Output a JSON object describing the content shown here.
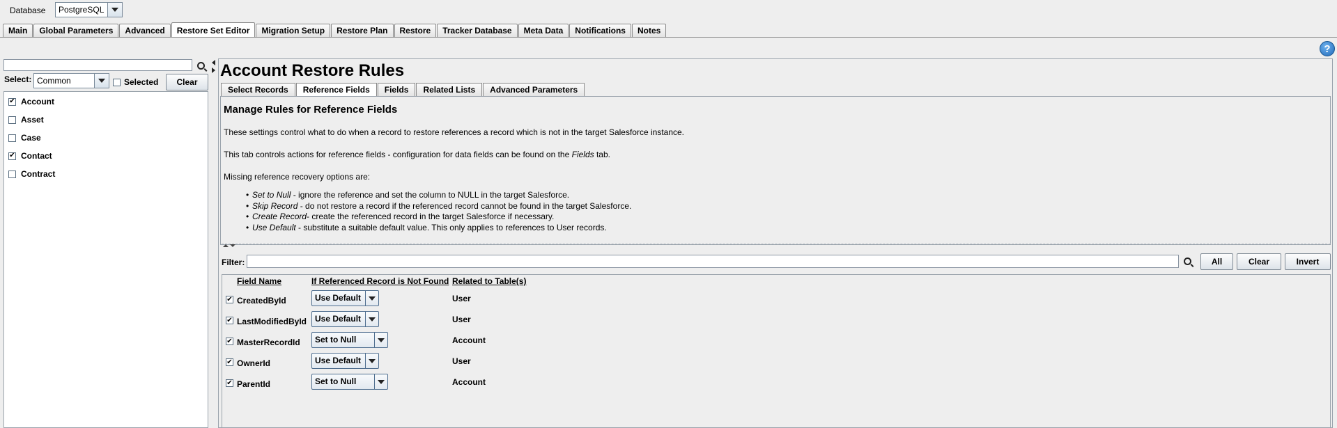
{
  "database": {
    "label": "Database",
    "value": "PostgreSQL"
  },
  "main_tabs": [
    {
      "label": "Main"
    },
    {
      "label": "Global Parameters"
    },
    {
      "label": "Advanced"
    },
    {
      "label": "Restore Set Editor"
    },
    {
      "label": "Migration Setup"
    },
    {
      "label": "Restore Plan"
    },
    {
      "label": "Restore"
    },
    {
      "label": "Tracker Database"
    },
    {
      "label": "Meta Data"
    },
    {
      "label": "Notifications"
    },
    {
      "label": "Notes"
    }
  ],
  "active_main_tab": "Restore Set Editor",
  "left": {
    "search_value": "",
    "select_label": "Select:",
    "select_value": "Common",
    "selected_label": "Selected",
    "clear_label": "Clear",
    "objects": [
      {
        "label": "Account",
        "checked": true
      },
      {
        "label": "Asset",
        "checked": false
      },
      {
        "label": "Case",
        "checked": false
      },
      {
        "label": "Contact",
        "checked": true
      },
      {
        "label": "Contract",
        "checked": false
      }
    ]
  },
  "right": {
    "title": "Account Restore Rules",
    "tabs": [
      {
        "label": "Select Records"
      },
      {
        "label": "Reference Fields"
      },
      {
        "label": "Fields"
      },
      {
        "label": "Related Lists"
      },
      {
        "label": "Advanced Parameters"
      }
    ],
    "active_tab": "Reference Fields",
    "info": {
      "heading": "Manage Rules for Reference Fields",
      "p1": "These settings control what to do when a record to restore references a record which is not in the target Salesforce instance.",
      "p2_pre": "This tab controls actions for reference fields - configuration for data fields can be found on the ",
      "p2_em": "Fields",
      "p2_post": " tab.",
      "p3": "Missing reference recovery options are:",
      "options": [
        {
          "name": "Set to Null",
          "desc": " - ignore the reference and set the column to NULL in the target Salesforce."
        },
        {
          "name": "Skip Record",
          "desc": " - do not restore a record if the referenced record cannot be found in the target Salesforce."
        },
        {
          "name": "Create Record",
          "desc": "- create the referenced record in the target Salesforce if necessary."
        },
        {
          "name": "Use Default",
          "desc": " - substitute a suitable default value. This only applies to references to User records."
        }
      ]
    },
    "filter": {
      "label": "Filter:",
      "value": "",
      "all_label": "All",
      "clear_label": "Clear",
      "invert_label": "Invert"
    },
    "table": {
      "headers": [
        "Field Name",
        "If Referenced Record is Not Found",
        "Related to Table(s)"
      ],
      "rows": [
        {
          "field": "CreatedById",
          "action": "Use Default",
          "related": "User",
          "checked": true
        },
        {
          "field": "LastModifiedById",
          "action": "Use Default",
          "related": "User",
          "checked": true
        },
        {
          "field": "MasterRecordId",
          "action": "Set to Null",
          "related": "Account",
          "checked": true
        },
        {
          "field": "OwnerId",
          "action": "Use Default",
          "related": "User",
          "checked": true
        },
        {
          "field": "ParentId",
          "action": "Set to Null",
          "related": "Account",
          "checked": true
        }
      ]
    }
  },
  "colors": {
    "help_blue": "#1f68b8",
    "border": "#9aa3ac"
  }
}
